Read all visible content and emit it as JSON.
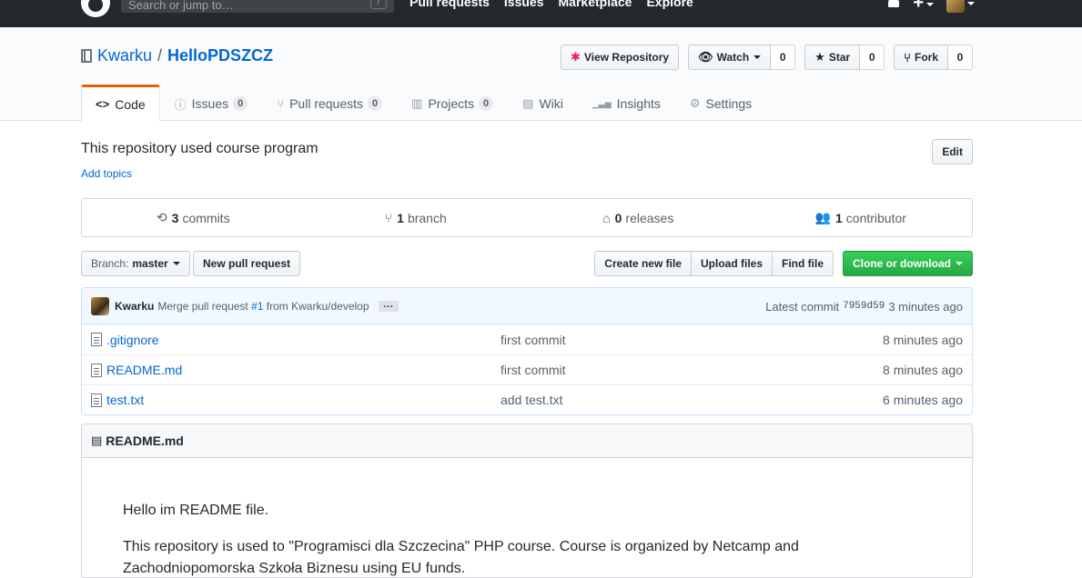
{
  "header": {
    "search_placeholder": "Search or jump to…",
    "search_shortcut": "/",
    "nav": [
      "Pull requests",
      "Issues",
      "Marketplace",
      "Explore"
    ],
    "plus": "+"
  },
  "repo": {
    "owner": "Kwarku",
    "separator": "/",
    "name": "HelloPDSZCZ"
  },
  "actions": {
    "view_repository": "View Repository",
    "watch": "Watch",
    "watch_count": "0",
    "star": "Star",
    "star_count": "0",
    "fork": "Fork",
    "fork_count": "0"
  },
  "tabs": [
    {
      "label": "Code",
      "icon": "<>",
      "counter": ""
    },
    {
      "label": "Issues",
      "icon": "ⓘ",
      "counter": "0"
    },
    {
      "label": "Pull requests",
      "icon": "⑂",
      "counter": "0"
    },
    {
      "label": "Projects",
      "icon": "▥",
      "counter": "0"
    },
    {
      "label": "Wiki",
      "icon": "▤",
      "counter": ""
    },
    {
      "label": "Insights",
      "icon": "▁▃▅",
      "counter": ""
    },
    {
      "label": "Settings",
      "icon": "⚙",
      "counter": ""
    }
  ],
  "description": {
    "text": "This repository used course program",
    "add_topics": "Add topics",
    "edit": "Edit"
  },
  "numbers": {
    "commits_count": "3",
    "commits_label": "commits",
    "branch_count": "1",
    "branch_label": "branch",
    "releases_count": "0",
    "releases_label": "releases",
    "contributor_count": "1",
    "contributor_label": "contributor"
  },
  "filenav": {
    "branch_prefix": "Branch:",
    "branch": "master",
    "new_pull_request": "New pull request",
    "create_new_file": "Create new file",
    "upload_files": "Upload files",
    "find_file": "Find file",
    "clone_or_download": "Clone or download"
  },
  "commit": {
    "author": "Kwarku",
    "message_prefix": "Merge pull request",
    "pr_link": "#1",
    "message_suffix": "from Kwarku/develop",
    "ellipsis": "…",
    "latest_label": "Latest commit",
    "sha": "7959d59",
    "age": "3 minutes ago"
  },
  "files": [
    {
      "name": ".gitignore",
      "message": "first commit",
      "age": "8 minutes ago"
    },
    {
      "name": "README.md",
      "message": "first commit",
      "age": "8 minutes ago"
    },
    {
      "name": "test.txt",
      "message": "add test.txt",
      "age": "6 minutes ago"
    }
  ],
  "readme": {
    "title": "README.md",
    "p1": "Hello im README file.",
    "p2": "This repository is used to \"Programisci dla Szczecina\" PHP course. Course is organized by Netcamp and Zachodniopomorska Szkoła Biznesu using EU funds."
  },
  "colors": {
    "header_bg": "#24292e",
    "link": "#0366d6",
    "tab_accent": "#e36209",
    "primary_button": "#28a745"
  }
}
